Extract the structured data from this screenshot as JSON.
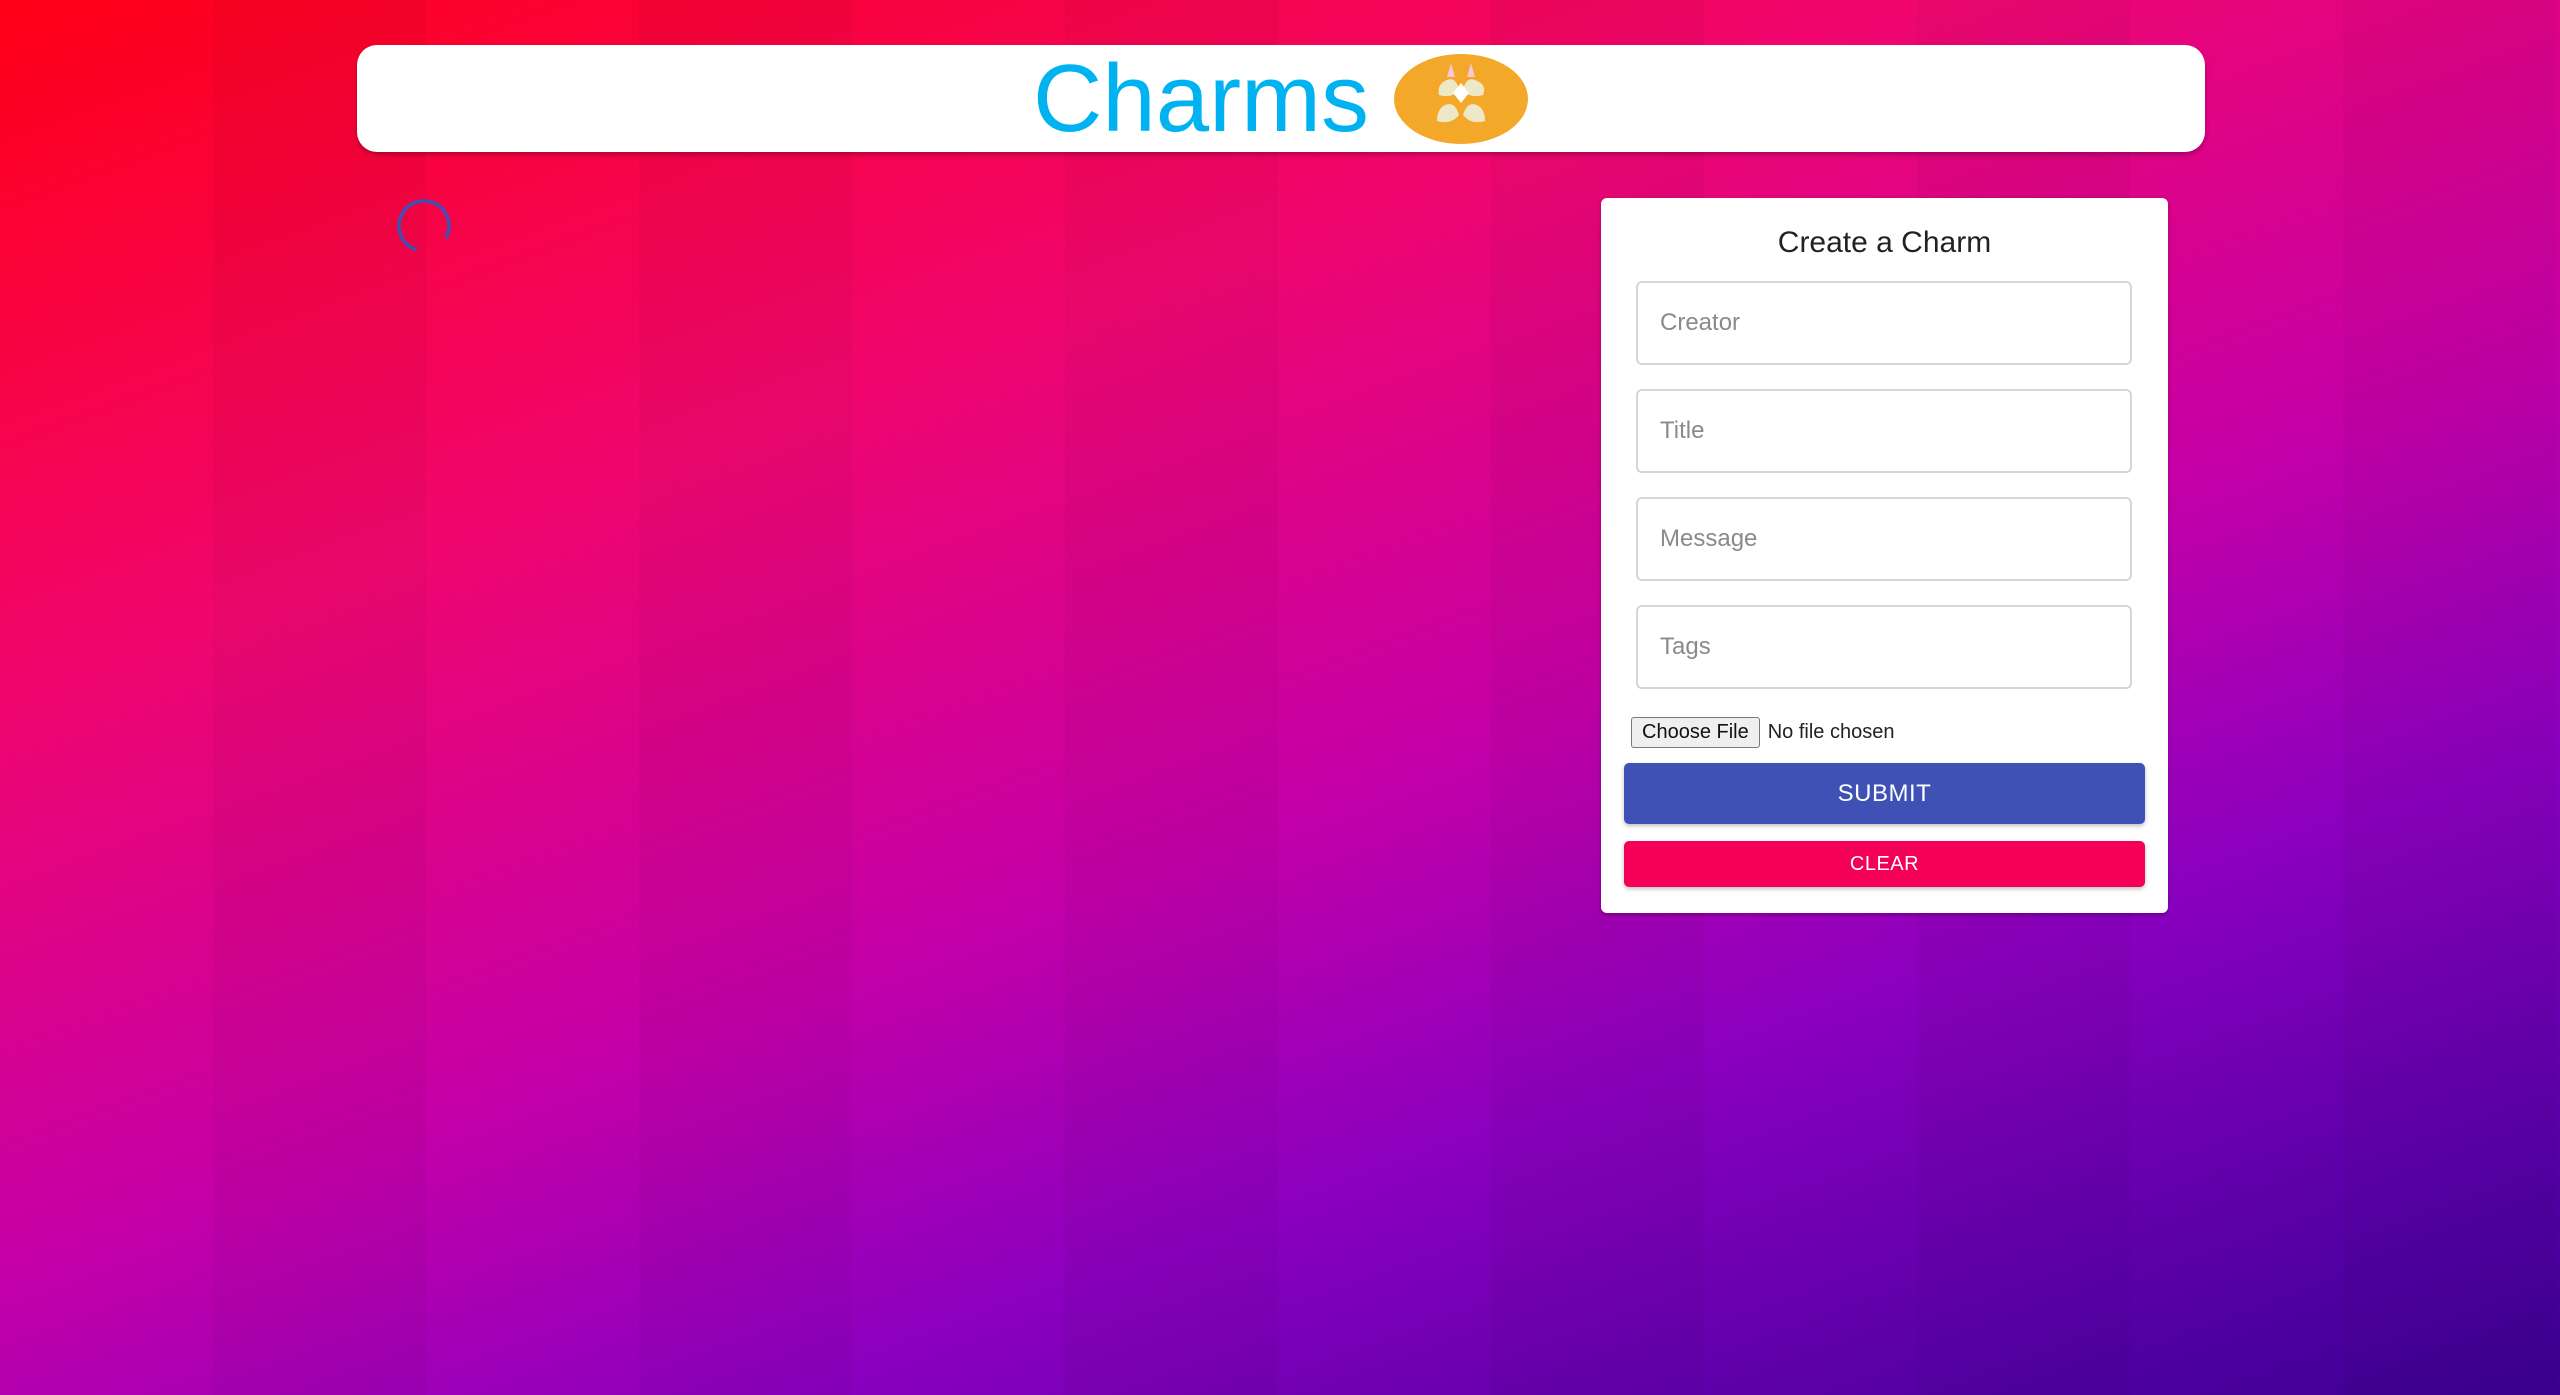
{
  "header": {
    "title": "Charms",
    "logo_icon": "charms-logo-icon"
  },
  "loading": {
    "icon": "loading-spinner-icon",
    "color": "#3f51b5"
  },
  "form": {
    "title": "Create a Charm",
    "fields": {
      "creator": {
        "placeholder": "Creator",
        "value": ""
      },
      "title": {
        "placeholder": "Title",
        "value": ""
      },
      "message": {
        "placeholder": "Message",
        "value": ""
      },
      "tags": {
        "placeholder": "Tags",
        "value": ""
      }
    },
    "file": {
      "button_label": "Choose File",
      "status": "No file chosen"
    },
    "submit_label": "SUBMIT",
    "clear_label": "CLEAR"
  },
  "colors": {
    "brand": "#00b3f0",
    "primary": "#3f51b5",
    "secondary": "#f50057",
    "logo_bg": "#f4a82a"
  }
}
